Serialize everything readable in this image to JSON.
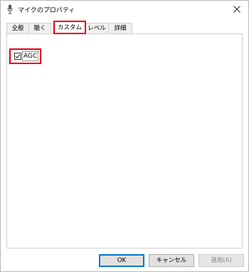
{
  "window": {
    "title": "マイクのプロパティ",
    "icon": "microphone-icon",
    "close_icon": "close-icon"
  },
  "tabs": [
    {
      "label": "全般",
      "active": false
    },
    {
      "label": "聴く",
      "active": false
    },
    {
      "label": "カスタム",
      "active": true
    },
    {
      "label": "レベル",
      "active": false
    },
    {
      "label": "詳細",
      "active": false
    }
  ],
  "custom": {
    "agc_label": "AGC",
    "agc_checked": true
  },
  "buttons": {
    "ok": "OK",
    "cancel": "キャンセル",
    "apply": "適用(A)"
  },
  "colors": {
    "highlight": "#e60012",
    "ok_border": "#0078d7"
  }
}
